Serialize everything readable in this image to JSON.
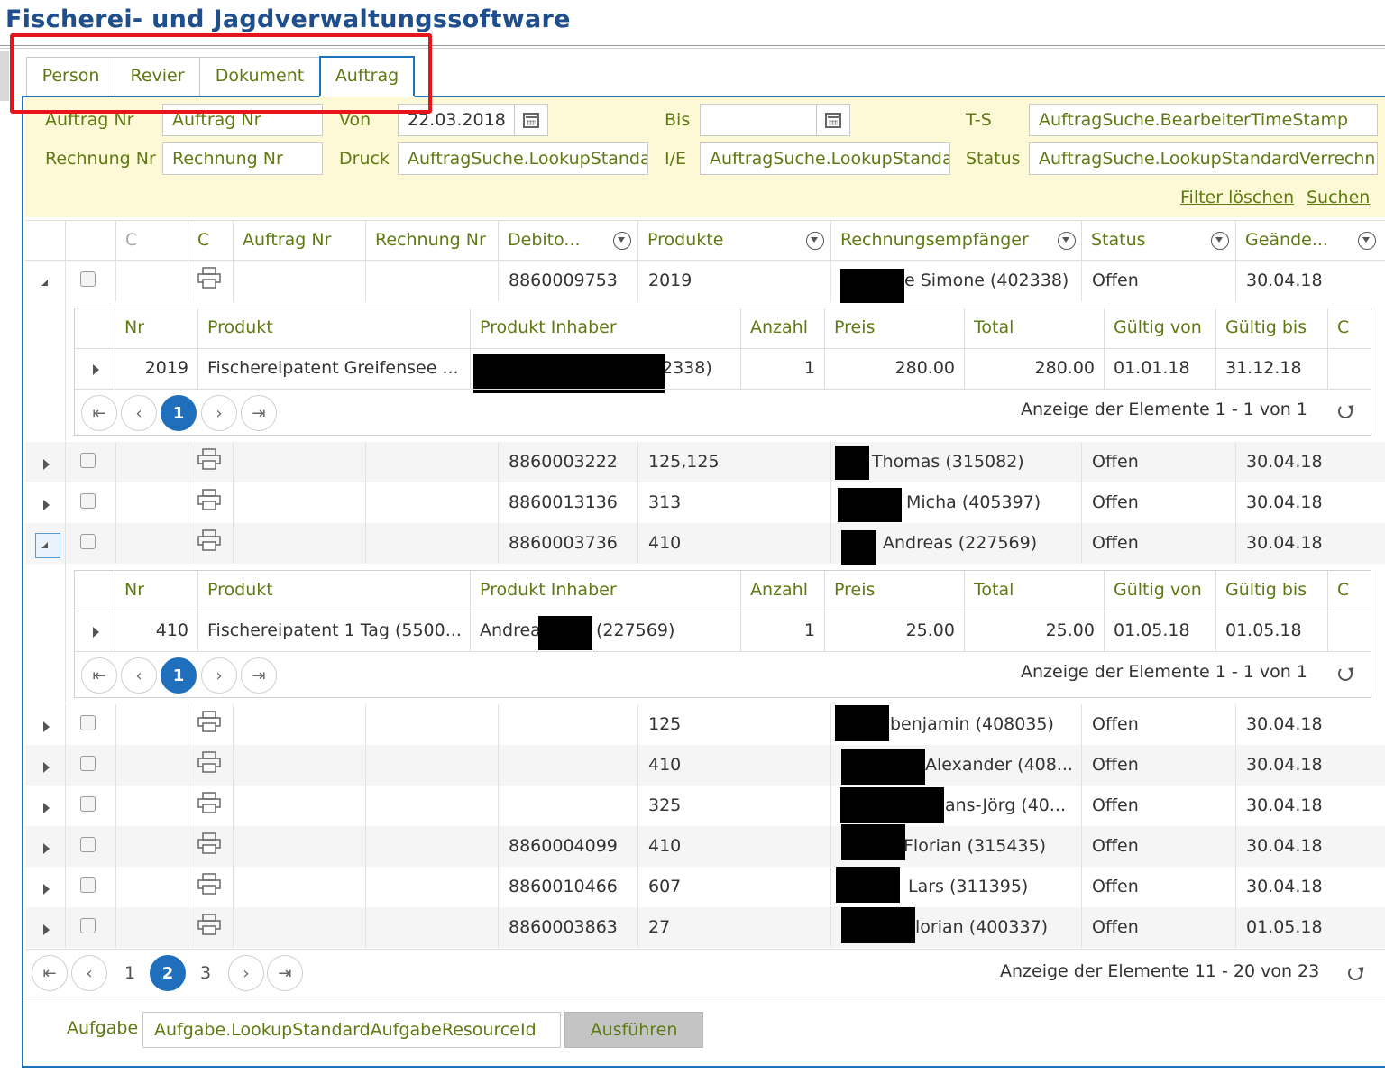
{
  "app": {
    "title": "Fischerei- und Jagdverwaltungssoftware"
  },
  "tabs": [
    {
      "label": "Person"
    },
    {
      "label": "Revier"
    },
    {
      "label": "Dokument"
    },
    {
      "label": "Auftrag",
      "active": true
    }
  ],
  "filters": {
    "auftrag_nr_label": "Auftrag Nr",
    "auftrag_nr_placeholder": "Auftrag Nr",
    "rechnung_nr_label": "Rechnung Nr",
    "rechnung_nr_placeholder": "Rechnung Nr",
    "von_label": "Von",
    "von_value": "22.03.2018",
    "bis_label": "Bis",
    "bis_value": "",
    "druck_label": "Druck",
    "druck_value": "AuftragSuche.LookupStandardDruck",
    "ie_label": "I/E",
    "ie_value": "AuftragSuche.LookupStandardIE",
    "ts_label": "T-S",
    "ts_value": "AuftragSuche.BearbeiterTimeStamp",
    "status_label": "Status",
    "status_value": "AuftragSuche.LookupStandardVerrechnung",
    "clear_link": "Filter löschen",
    "search_link": "Suchen"
  },
  "grid": {
    "headers": {
      "c1": "C",
      "c2": "C",
      "auftrag_nr": "Auftrag Nr",
      "rechnung_nr": "Rechnung Nr",
      "debitor": "Debito...",
      "produkte": "Produkte",
      "empfaenger": "Rechnungsempfänger",
      "status": "Status",
      "geaendert": "Geände..."
    },
    "rows": [
      {
        "debitor": "8860009753",
        "produkte": "2019",
        "empfaenger": "e Simone (402338)",
        "status": "Offen",
        "geaendert": "30.04.18"
      },
      {
        "debitor": "8860003222",
        "produkte": "125,125",
        "empfaenger": "Thomas (315082)",
        "status": "Offen",
        "geaendert": "30.04.18"
      },
      {
        "debitor": "8860013136",
        "produkte": "313",
        "empfaenger": "Micha (405397)",
        "status": "Offen",
        "geaendert": "30.04.18"
      },
      {
        "debitor": "8860003736",
        "produkte": "410",
        "empfaenger": "Andreas (227569)",
        "status": "Offen",
        "geaendert": "30.04.18"
      },
      {
        "debitor": "",
        "produkte": "125",
        "empfaenger": "benjamin (408035)",
        "status": "Offen",
        "geaendert": "30.04.18"
      },
      {
        "debitor": "",
        "produkte": "410",
        "empfaenger": "Alexander (408...",
        "status": "Offen",
        "geaendert": "30.04.18"
      },
      {
        "debitor": "",
        "produkte": "325",
        "empfaenger": "ans-Jörg (40...",
        "status": "Offen",
        "geaendert": "30.04.18"
      },
      {
        "debitor": "8860004099",
        "produkte": "410",
        "empfaenger": "Florian (315435)",
        "status": "Offen",
        "geaendert": "30.04.18"
      },
      {
        "debitor": "8860010466",
        "produkte": "607",
        "empfaenger": "Lars (311395)",
        "status": "Offen",
        "geaendert": "30.04.18"
      },
      {
        "debitor": "8860003863",
        "produkte": "27",
        "empfaenger": "lorian (400337)",
        "status": "Offen",
        "geaendert": "01.05.18"
      }
    ]
  },
  "detail_headers": {
    "nr": "Nr",
    "produkt": "Produkt",
    "inhaber": "Produkt Inhaber",
    "anzahl": "Anzahl",
    "preis": "Preis",
    "total": "Total",
    "von": "Gültig von",
    "bis": "Gültig bis",
    "c": "C"
  },
  "detail1": {
    "nr": "2019",
    "produkt": "Fischereipatent Greifensee ...",
    "inhaber": "2338)",
    "anzahl": "1",
    "preis": "280.00",
    "total": "280.00",
    "von": "01.01.18",
    "bis": "31.12.18",
    "pager_page": "1",
    "pager_info": "Anzeige der Elemente 1 - 1 von 1"
  },
  "detail2": {
    "nr": "410",
    "produkt": "Fischereipatent 1 Tag (5500...",
    "inhaber_a": "Andrea",
    "inhaber_b": "(227569)",
    "anzahl": "1",
    "preis": "25.00",
    "total": "25.00",
    "von": "01.05.18",
    "bis": "01.05.18",
    "pager_page": "1",
    "pager_info": "Anzeige der Elemente 1 - 1 von 1"
  },
  "pager": {
    "pages": [
      "1",
      "2",
      "3"
    ],
    "current": "2",
    "info": "Anzeige der Elemente 11 - 20 von 23"
  },
  "footer": {
    "aufgabe_label": "Aufgabe",
    "aufgabe_value": "Aufgabe.LookupStandardAufgabeResourceId",
    "execute_label": "Ausführen"
  },
  "colors": {
    "accent": "#1f6fbd",
    "label_green": "#5e7a12",
    "filter_bg": "#fdf8d6",
    "highlight_red": "#e8141b"
  }
}
